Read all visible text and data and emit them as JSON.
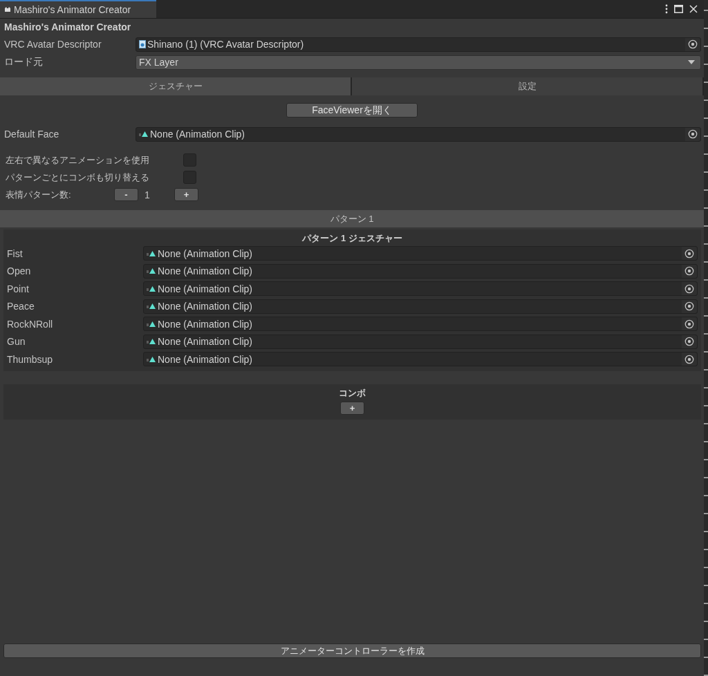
{
  "window": {
    "title": "Mashiro's Animator Creator"
  },
  "header": {
    "title": "Mashiro's Animator Creator"
  },
  "fields": [
    {
      "kind": "object",
      "label": "VRC Avatar Descriptor",
      "value": "Shinano (1) (VRC Avatar Descriptor)"
    },
    {
      "kind": "dropdown",
      "label": "ロード元",
      "value": "FX Layer"
    }
  ],
  "tabs": [
    {
      "label": "ジェスチャー",
      "selected": true
    },
    {
      "label": "設定",
      "selected": false
    }
  ],
  "face_viewer_button": "FaceViewerを開く",
  "default_face": {
    "label": "Default Face",
    "value": "None (Animation Clip)"
  },
  "toggles": [
    {
      "label": "左右で異なるアニメーションを使用",
      "checked": false
    },
    {
      "label": "パターンごとにコンボも切り替える",
      "checked": false
    }
  ],
  "pattern_count": {
    "label": "表情パターン数:",
    "minus": "-",
    "value": "1",
    "plus": "+"
  },
  "pattern_header": "パターン 1",
  "gesture_group": {
    "title": "パターン 1 ジェスチャー",
    "rows": [
      {
        "label": "Fist",
        "value": "None (Animation Clip)"
      },
      {
        "label": "Open",
        "value": "None (Animation Clip)"
      },
      {
        "label": "Point",
        "value": "None (Animation Clip)"
      },
      {
        "label": "Peace",
        "value": "None (Animation Clip)"
      },
      {
        "label": "RockNRoll",
        "value": "None (Animation Clip)"
      },
      {
        "label": "Gun",
        "value": "None (Animation Clip)"
      },
      {
        "label": "Thumbsup",
        "value": "None (Animation Clip)"
      }
    ]
  },
  "combo": {
    "title": "コンボ",
    "add": "+"
  },
  "create_button": "アニメーターコントローラーを作成"
}
